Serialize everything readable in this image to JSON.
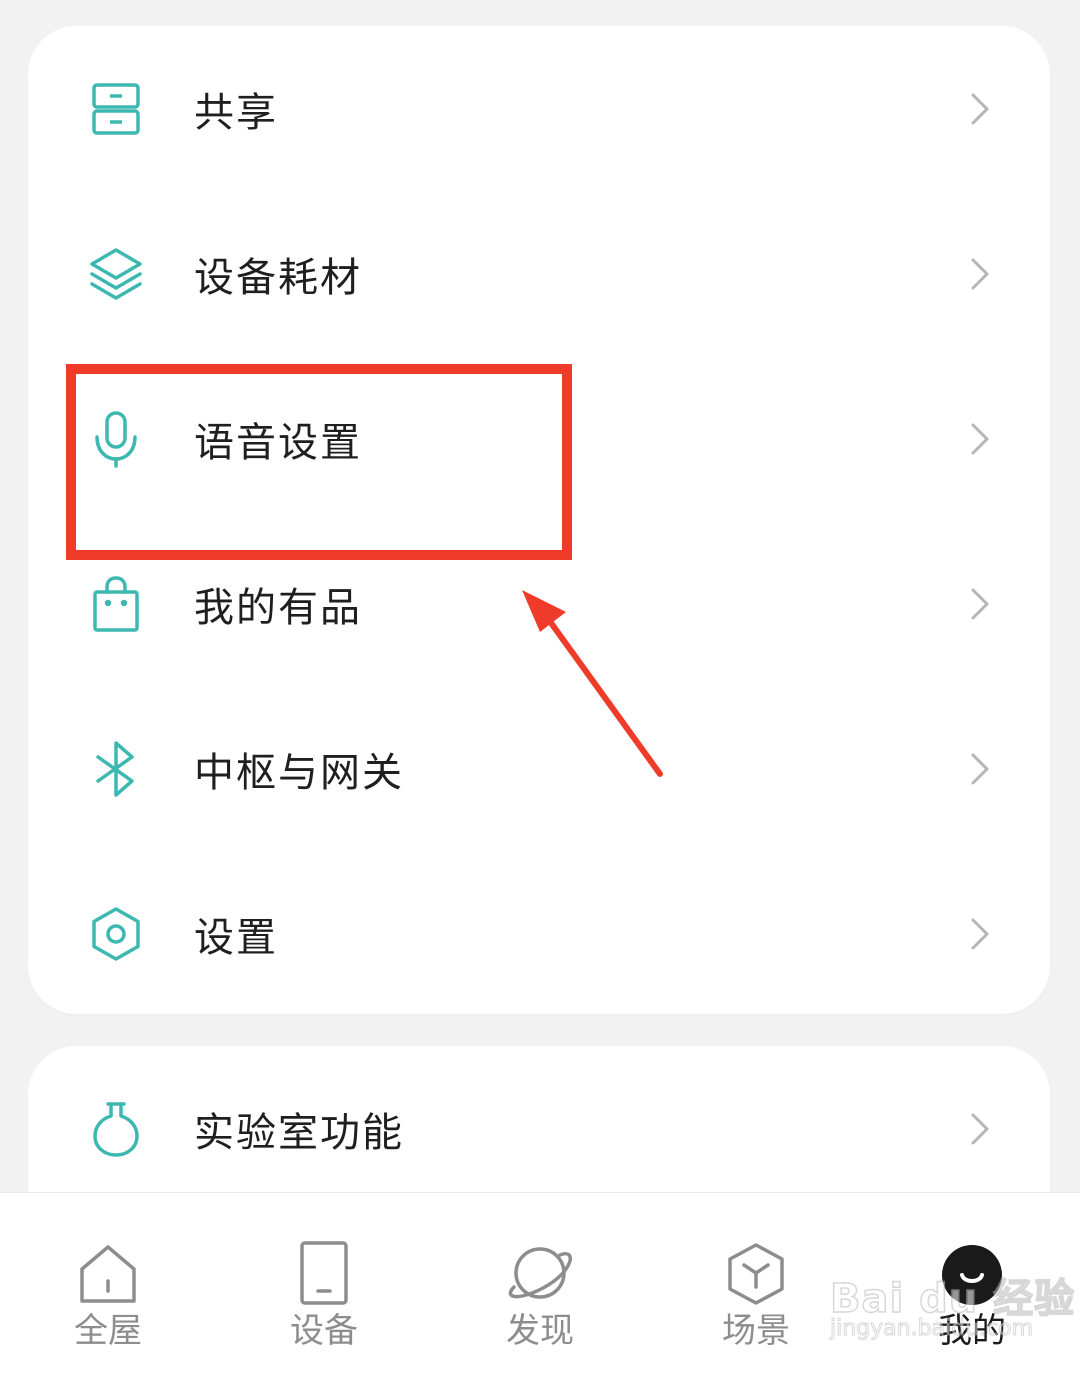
{
  "menu": {
    "items": [
      {
        "label": "共享",
        "icon": "share-drawer-icon"
      },
      {
        "label": "设备耗材",
        "icon": "layers-icon"
      },
      {
        "label": "语音设置",
        "icon": "microphone-icon"
      },
      {
        "label": "我的有品",
        "icon": "shopping-bag-icon"
      },
      {
        "label": "中枢与网关",
        "icon": "bluetooth-icon"
      },
      {
        "label": "设置",
        "icon": "hexagon-settings-icon"
      }
    ]
  },
  "lab": {
    "label": "实验室功能",
    "icon": "flask-icon"
  },
  "tabbar": {
    "tabs": [
      {
        "label": "全屋",
        "icon": "home-icon"
      },
      {
        "label": "设备",
        "icon": "device-icon"
      },
      {
        "label": "发现",
        "icon": "planet-icon"
      },
      {
        "label": "场景",
        "icon": "cube-icon"
      },
      {
        "label": "我的",
        "icon": "smiley-avatar-icon",
        "active": true
      }
    ]
  },
  "watermark": {
    "line1": "Bai du 经验",
    "line2": "jingyan.baidu.com"
  },
  "colors": {
    "accent_teal": "#3db8b0",
    "annotation_red": "#ef3b2a",
    "chevron_gray": "#b5b5b5",
    "background": "#f2f2f2",
    "card": "#ffffff"
  }
}
